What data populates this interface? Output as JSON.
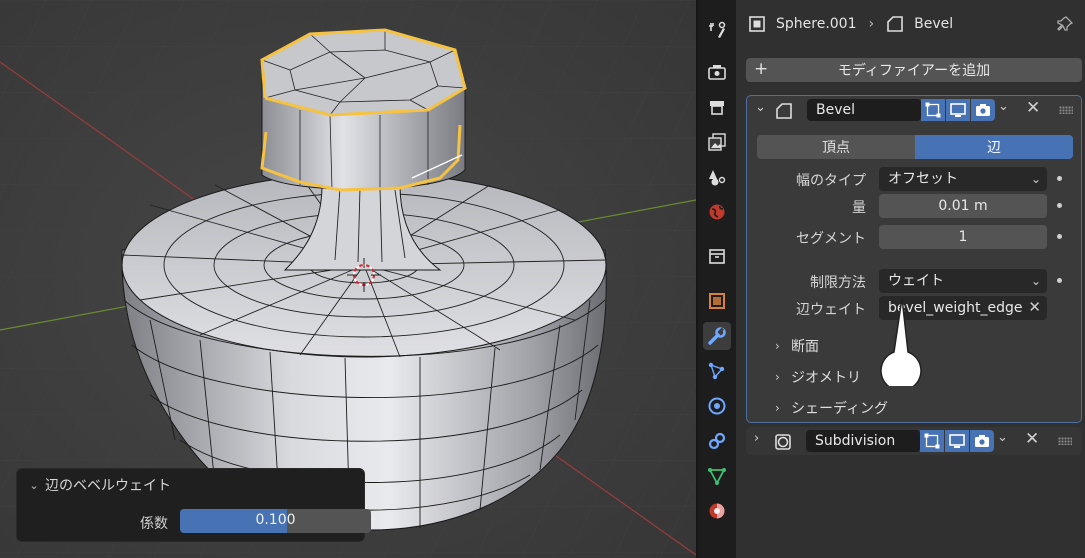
{
  "header": {
    "object_name": "Sphere.001",
    "modifier_name": "Bevel"
  },
  "add_modifier_label": "モディファイアーを追加",
  "bevel": {
    "name": "Bevel",
    "affect_tabs": [
      "頂点",
      "辺"
    ],
    "active_tab": "辺",
    "width_type_label": "幅のタイプ",
    "width_type_value": "オフセット",
    "amount_label": "量",
    "amount_value": "0.01 m",
    "segments_label": "セグメント",
    "segments_value": "1",
    "limit_method_label": "制限方法",
    "limit_method_value": "ウェイト",
    "edge_weight_label": "辺ウェイト",
    "edge_weight_value": "bevel_weight_edge",
    "subpanels": [
      "断面",
      "ジオメトリ",
      "シェーディング"
    ]
  },
  "subdivision": {
    "name": "Subdivision"
  },
  "redo_panel": {
    "title": "辺のベベルウェイト",
    "factor_label": "係数",
    "factor_value": "0.100"
  },
  "tabs": [
    "tool-icon",
    "render-icon",
    "output-icon",
    "view-layer-icon",
    "scene-icon",
    "world-icon",
    "collection-icon",
    "texture-icon",
    "modifier-icon",
    "particles-icon",
    "physics-icon",
    "constraints-icon",
    "data-icon",
    "material-icon"
  ],
  "colors": {
    "accent": "#4772b3",
    "selection": "#f5c242",
    "panel": "#303030",
    "viewport": "#3c3c3c"
  }
}
